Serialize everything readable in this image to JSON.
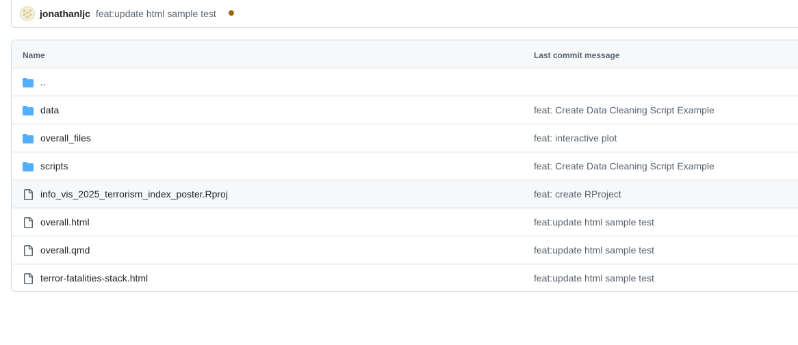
{
  "latest_commit": {
    "author": "jonathanljc",
    "message": "feat:update html sample test",
    "status_color": "#9a6700"
  },
  "table": {
    "headers": {
      "name": "Name",
      "last_commit": "Last commit message"
    },
    "rows": [
      {
        "type": "folder",
        "name": "..",
        "commit": ""
      },
      {
        "type": "folder",
        "name": "data",
        "commit": "feat: Create Data Cleaning Script Example"
      },
      {
        "type": "folder",
        "name": "overall_files",
        "commit": "feat: interactive plot"
      },
      {
        "type": "folder",
        "name": "scripts",
        "commit": "feat: Create Data Cleaning Script Example"
      },
      {
        "type": "file",
        "name": "info_vis_2025_terrorism_index_poster.Rproj",
        "commit": "feat: create RProject"
      },
      {
        "type": "file",
        "name": "overall.html",
        "commit": "feat:update html sample test"
      },
      {
        "type": "file",
        "name": "overall.qmd",
        "commit": "feat:update html sample test"
      },
      {
        "type": "file",
        "name": "terror-fatalities-stack.html",
        "commit": "feat:update html sample test"
      }
    ]
  },
  "colors": {
    "folder_icon": "#54aeff",
    "file_icon": "#59636e",
    "border": "#d1d9e0",
    "header_bg": "#f6f8fa"
  }
}
